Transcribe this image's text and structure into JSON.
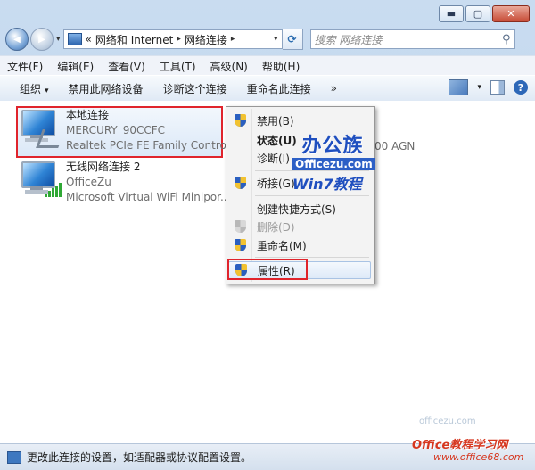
{
  "window": {
    "caption_buttons": {
      "minimize": "▬",
      "maximize": "▢",
      "close": "✕"
    }
  },
  "nav": {
    "back_glyph": "◀",
    "forward_glyph": "▶",
    "dropdown_glyph": "▾",
    "breadcrumb": [
      "网络和 Internet",
      "网络连接"
    ],
    "breadcrumb_prefix": "«",
    "separator": "▸",
    "refresh_glyph": "⟳",
    "search_placeholder": "搜索 网络连接",
    "search_glyph": "⚲"
  },
  "menubar": [
    "文件(F)",
    "编辑(E)",
    "查看(V)",
    "工具(T)",
    "高级(N)",
    "帮助(H)"
  ],
  "commands": {
    "organize": "组织",
    "disable": "禁用此网络设备",
    "diagnose": "诊断这个连接",
    "rename": "重命名此连接",
    "more": "»",
    "help": "?"
  },
  "connections": [
    {
      "name": "本地连接",
      "status": "MERCURY_90CCFC",
      "adapter": "Realtek PCIe FE Family Control..."
    },
    {
      "name": "无线网络连接 2",
      "status": "OfficeZu",
      "adapter": "Microsoft Virtual WiFi Minipor..."
    }
  ],
  "hidden_adapter_suffix": "00 AGN",
  "context_menu": {
    "disable": "禁用(B)",
    "status": "状态(U)",
    "diagnose": "诊断(I)",
    "bridge": "桥接(G)",
    "shortcut": "创建快捷方式(S)",
    "delete": "删除(D)",
    "rename": "重命名(M)",
    "properties": "属性(R)"
  },
  "watermarks": {
    "brand": "办公族",
    "brand_url": "Officezu.com",
    "win7": "Win7教程",
    "site_top": "officezu.com",
    "site_title": "Office教程学习网",
    "site_url": "www.office68.com"
  },
  "statusbar": {
    "text": "更改此连接的设置，如适配器或协议配置设置。"
  }
}
